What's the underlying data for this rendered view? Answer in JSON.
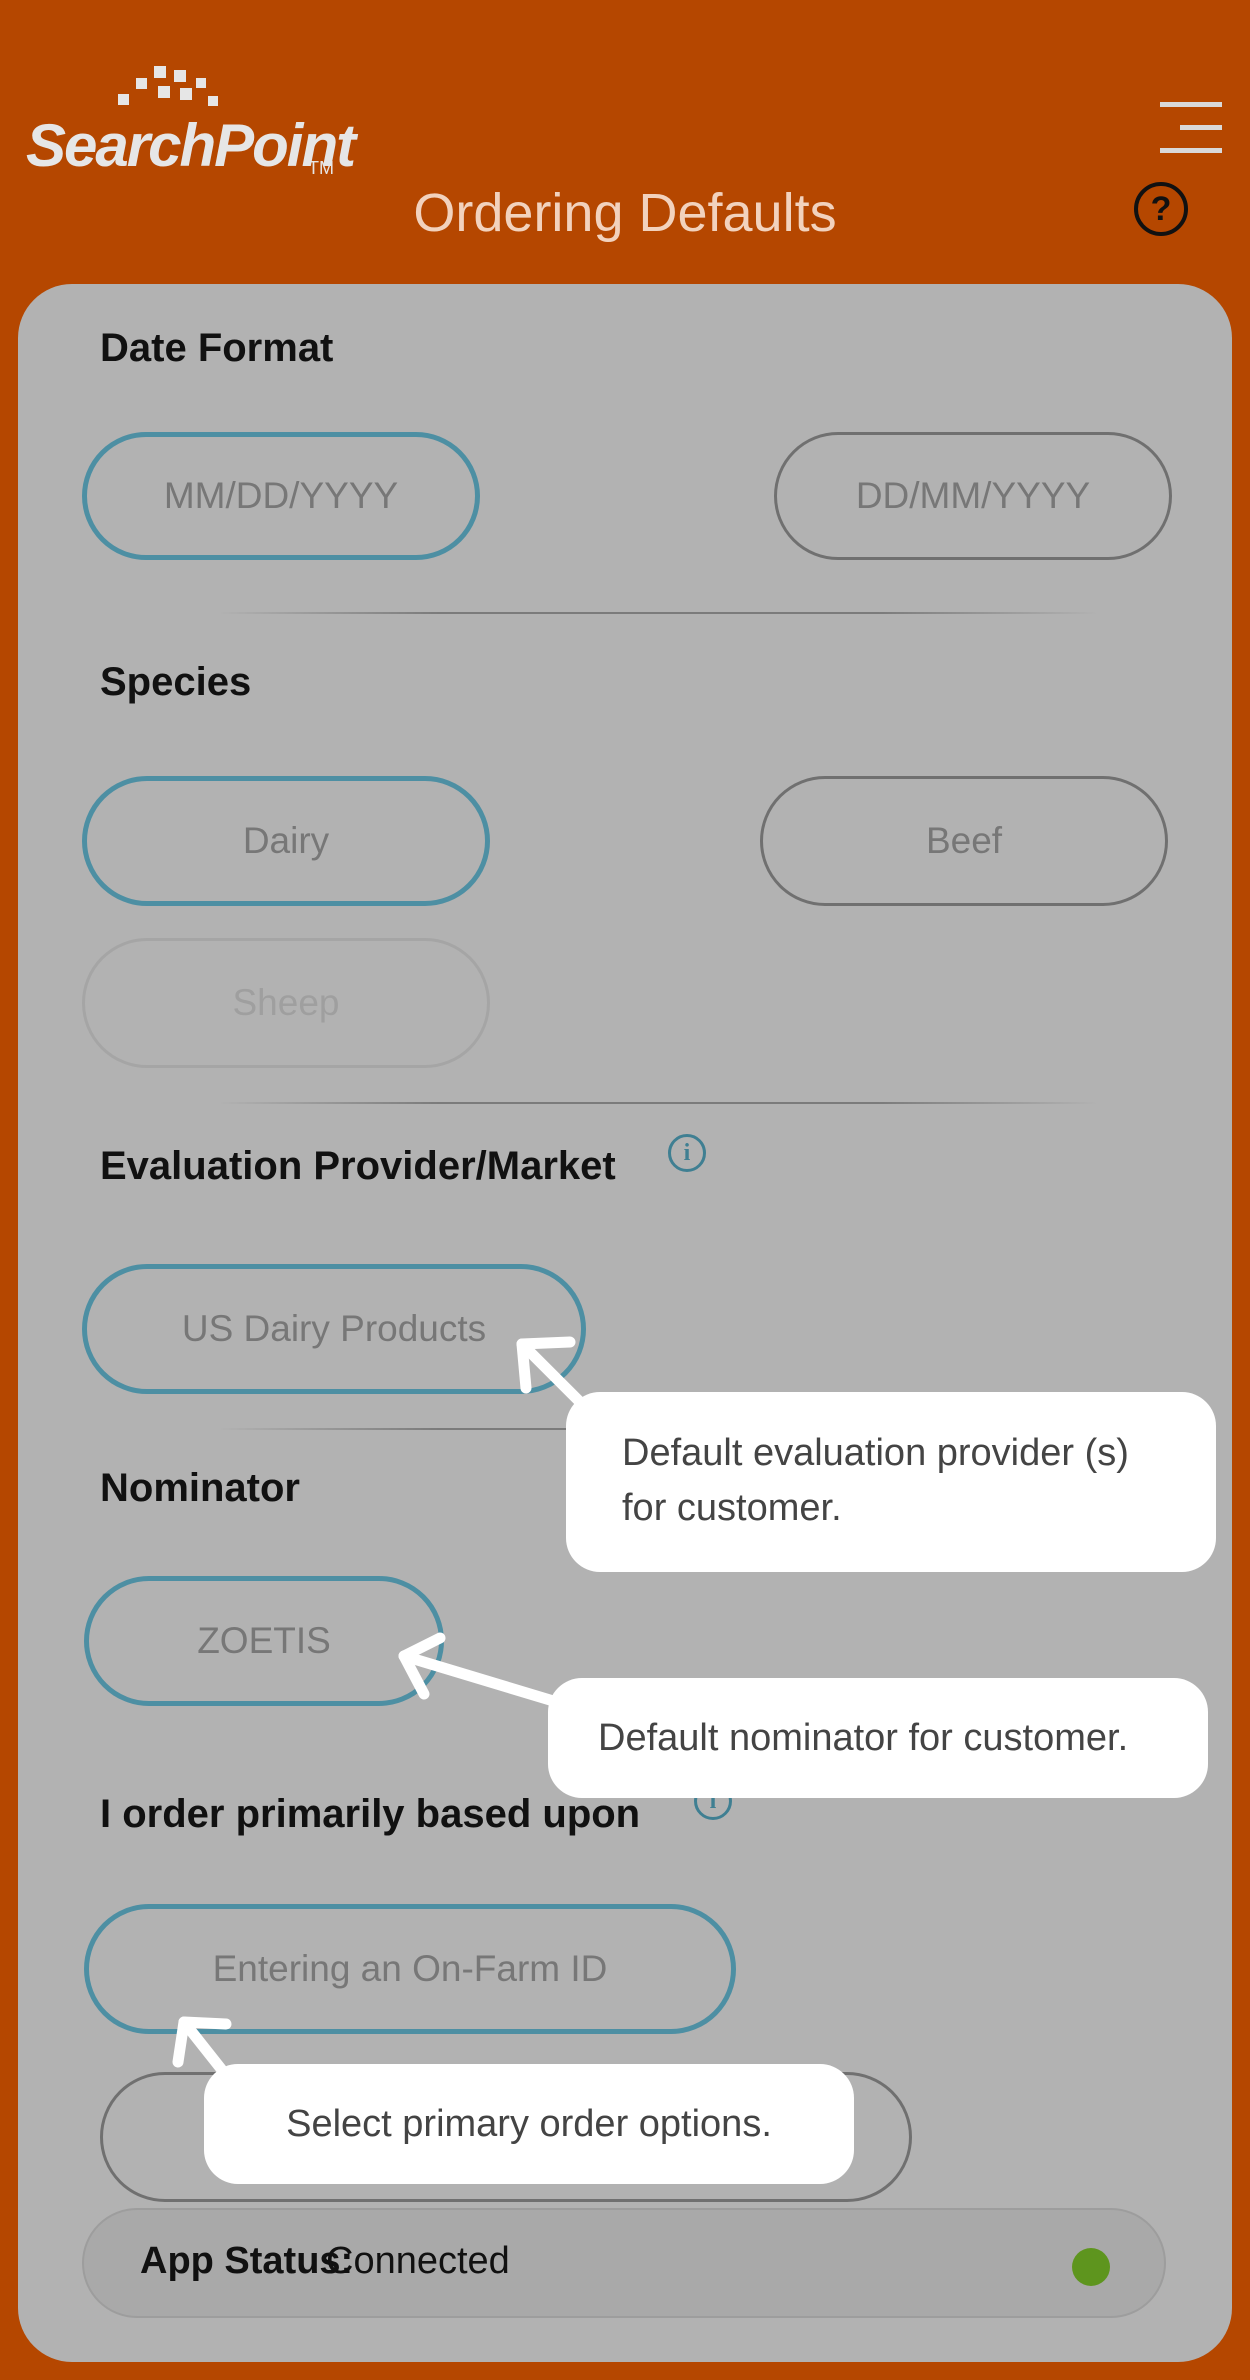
{
  "header": {
    "logo_text": "SearchPoint",
    "logo_tm": "TM",
    "title": "Ordering Defaults",
    "menu_icon": "hamburger-menu-icon",
    "help_icon": "question-mark-icon",
    "help_glyph": "?"
  },
  "sections": {
    "date_format": {
      "heading": "Date Format",
      "options": [
        "MM/DD/YYYY",
        "DD/MM/YYYY"
      ],
      "selected": "MM/DD/YYYY"
    },
    "species": {
      "heading": "Species",
      "options": [
        "Dairy",
        "Beef",
        "Sheep"
      ],
      "selected": "Dairy",
      "disabled": [
        "Sheep"
      ]
    },
    "evaluation": {
      "heading": "Evaluation Provider/Market",
      "info_glyph": "i",
      "options": [
        "US Dairy Products"
      ],
      "selected": "US Dairy Products"
    },
    "nominator": {
      "heading": "Nominator",
      "options": [
        "ZOETIS"
      ],
      "selected": "ZOETIS"
    },
    "order_basis": {
      "heading": "I order primarily based upon",
      "info_glyph": "i",
      "options": [
        "Entering an On-Farm ID"
      ],
      "selected": "Entering an On-Farm ID"
    }
  },
  "status": {
    "label": "App Status:",
    "value": "Connected",
    "indicator_color": "#5e951e"
  },
  "tooltips": {
    "evaluation": "Default evaluation provider (s) for customer.",
    "nominator": "Default nominator for customer.",
    "order": "Select primary order options."
  },
  "colors": {
    "brand": "#b54700",
    "panel": "#b2b2b2",
    "selected_border": "#4d8fa3"
  }
}
